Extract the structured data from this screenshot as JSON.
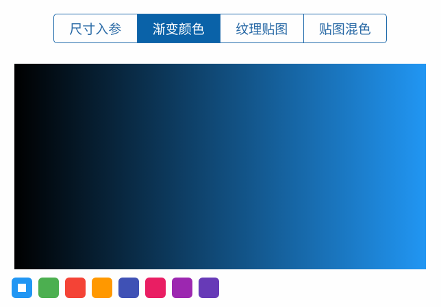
{
  "tabs": [
    {
      "label": "尺寸入参",
      "active": false
    },
    {
      "label": "渐变颜色",
      "active": true
    },
    {
      "label": "纹理贴图",
      "active": false
    },
    {
      "label": "贴图混色",
      "active": false
    }
  ],
  "gradient": {
    "from": "#000000",
    "to": "#2196F3",
    "direction": "left-to-right"
  },
  "swatches": [
    {
      "color": "#2196F3",
      "selected": true
    },
    {
      "color": "#4CAF50",
      "selected": false
    },
    {
      "color": "#F44336",
      "selected": false
    },
    {
      "color": "#FF9800",
      "selected": false
    },
    {
      "color": "#3F51B5",
      "selected": false
    },
    {
      "color": "#E91E63",
      "selected": false
    },
    {
      "color": "#9C27B0",
      "selected": false
    },
    {
      "color": "#673AB7",
      "selected": false
    }
  ]
}
